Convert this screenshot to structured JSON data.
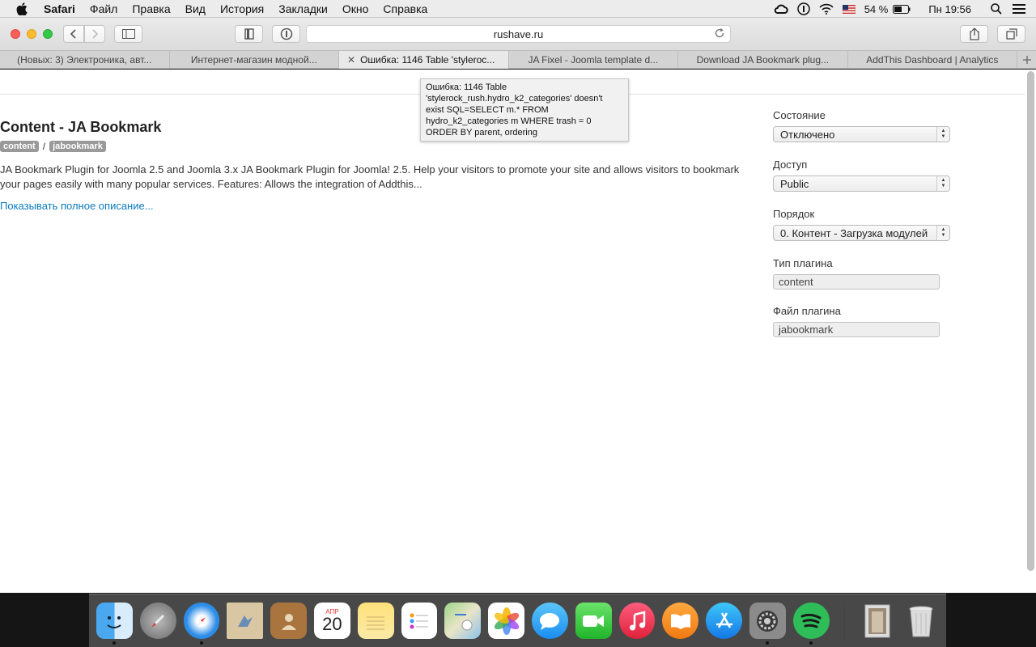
{
  "menubar": {
    "app": "Safari",
    "items": [
      "Файл",
      "Правка",
      "Вид",
      "История",
      "Закладки",
      "Окно",
      "Справка"
    ],
    "battery": "54 %",
    "clock": "Пн 19:56"
  },
  "toolbar": {
    "address": "rushave.ru"
  },
  "tabs": [
    {
      "label": "(Новых: 3) Электроника, авт..."
    },
    {
      "label": "Интернет-магазин модной..."
    },
    {
      "label": "Ошибка: 1146 Table 'styleroc..."
    },
    {
      "label": "JA Fixel - Joomla template d..."
    },
    {
      "label": "Download JA Bookmark plug..."
    },
    {
      "label": "AddThis Dashboard | Analytics"
    }
  ],
  "tooltip": "Ошибка: 1146 Table 'stylerock_rush.hydro_k2_categories' doesn't exist SQL=SELECT m.* FROM hydro_k2_categories m WHERE trash = 0 ORDER BY parent, ordering",
  "main": {
    "title": "Content - JA Bookmark",
    "badge1": "content",
    "separator": "/",
    "badge2": "jabookmark",
    "description": "JA Bookmark Plugin for Joomla 2.5 and Joomla 3.x JA Bookmark Plugin for Joomla! 2.5. Help your visitors to promote your site and allows visitors to bookmark your pages easily with many popular services. Features: Allows the integration of Addthis...",
    "more_link": "Показывать полное описание..."
  },
  "sidebar": {
    "status_label": "Состояние",
    "status_value": "Отключено",
    "access_label": "Доступ",
    "access_value": "Public",
    "order_label": "Порядок",
    "order_value": "0. Контент - Загрузка модулей",
    "type_label": "Тип плагина",
    "type_value": "content",
    "file_label": "Файл плагина",
    "file_value": "jabookmark"
  },
  "dock": {
    "calendar_month": "АПР",
    "calendar_day": "20",
    "icons": [
      "finder-icon",
      "launchpad-icon",
      "safari-icon",
      "mail-icon",
      "contacts-icon",
      "calendar-icon",
      "notes-icon",
      "reminders-icon",
      "maps-icon",
      "photos-icon",
      "messages-icon",
      "facetime-icon",
      "itunes-icon",
      "ibooks-icon",
      "app-store-icon",
      "system-preferences-icon",
      "spotify-icon",
      "downloads-icon",
      "trash-icon"
    ]
  }
}
